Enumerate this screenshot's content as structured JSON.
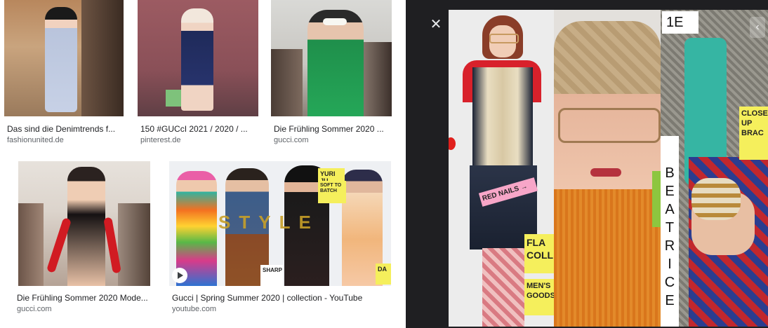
{
  "results": [
    {
      "title": "Das sind die Denimtrends f...",
      "source": "fashionunited.de"
    },
    {
      "title": "150 #GUCcI 2021 / 2020 / ...",
      "source": "pinterest.de"
    },
    {
      "title": "Die Frühling Sommer 2020 ...",
      "source": "gucci.com"
    },
    {
      "title": "Die Frühling Sommer 2020 Mode...",
      "source": "gucci.com"
    },
    {
      "title": "Gucci | Spring Summer 2020 | collection - YouTube",
      "source": "youtube.com"
    }
  ],
  "viewer": {
    "close_icon": "close-icon",
    "tag_1e": "1E",
    "vertical_name": [
      "B",
      "E",
      "A",
      "T",
      "R",
      "I",
      "C",
      "E"
    ],
    "note_flag": "FLA COLL",
    "note_mens": "MEN'S GOODS",
    "note_red_nails": "RED NAILS →",
    "note_close_up": "CLOSE UP BRAC"
  },
  "thumbnails": {
    "style_overlay": "STYLE",
    "note_yuri": "YURI JU",
    "note_soft": "SOFT TO BATCH",
    "note_sharp": "SHARP",
    "note_da": "DA"
  }
}
